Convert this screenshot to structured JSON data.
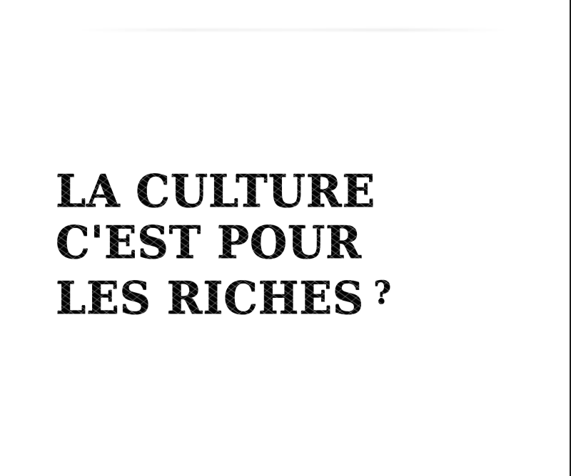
{
  "poster": {
    "line1": "LA CULTURE",
    "line2": "C'EST POUR",
    "line3": "LES RICHES",
    "question_mark": "?"
  }
}
